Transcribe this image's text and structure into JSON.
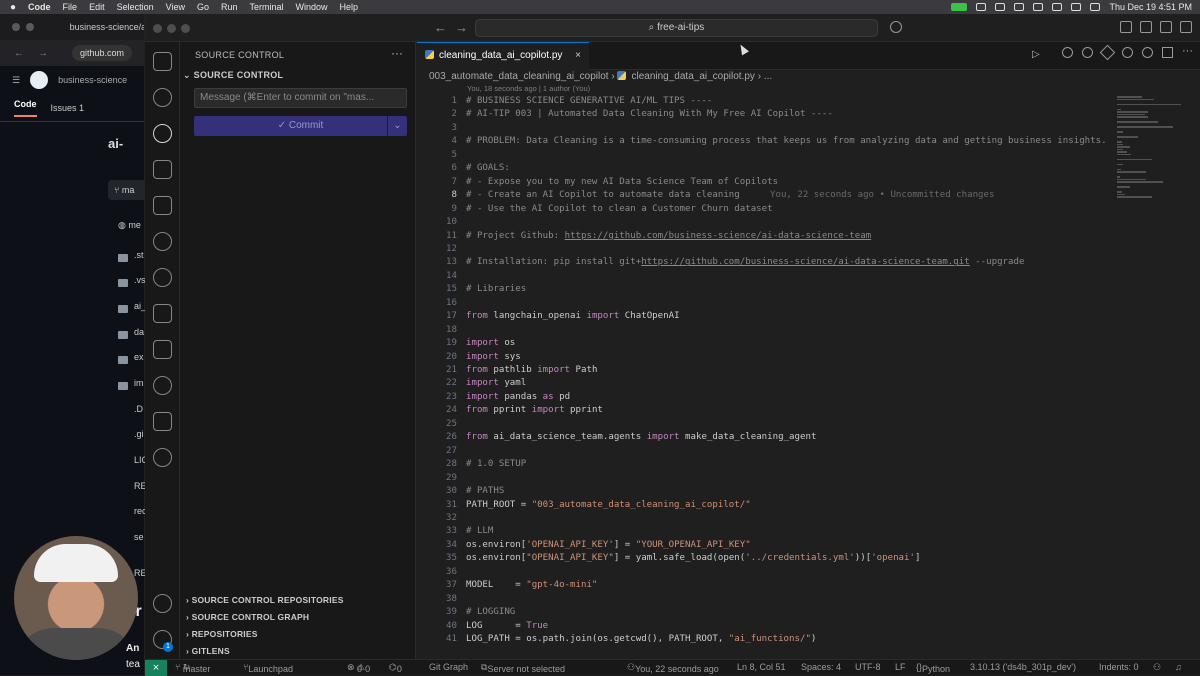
{
  "menubar": {
    "app": "Code",
    "items": [
      "File",
      "Edit",
      "Selection",
      "View",
      "Go",
      "Run",
      "Terminal",
      "Window",
      "Help"
    ],
    "datetime": "Thu Dec 19  4:51 PM"
  },
  "browser": {
    "tab_title": "business-science/a",
    "url": "github.com",
    "org": "business-science",
    "tab_code": "Code",
    "tab_issues": "Issues",
    "issues_count": "1",
    "repo_short": "ai-",
    "branch_short": "ma",
    "commit_short": "me",
    "files": [
      ".st",
      ".vs",
      "ai_",
      "da",
      "ex",
      "im",
      ".D",
      ".gi",
      "LIC",
      "RE",
      "rec",
      "se",
      "RE",
      "Ar",
      "An",
      "tea"
    ]
  },
  "window": {
    "command_center": "free-ai-tips"
  },
  "sidebar": {
    "title": "SOURCE CONTROL",
    "more": "···",
    "section": "SOURCE CONTROL",
    "message_placeholder": "Message (⌘Enter to commit on \"mas...",
    "commit_label": "✓ Commit",
    "panels": [
      "SOURCE CONTROL REPOSITORIES",
      "SOURCE CONTROL GRAPH",
      "REPOSITORIES",
      "GITLENS"
    ]
  },
  "editor": {
    "tab_label": "cleaning_data_ai_copilot.py",
    "tab_close": "×",
    "breadcrumb_folder": "003_automate_data_cleaning_ai_copilot",
    "breadcrumb_file": "cleaning_data_ai_copilot.py",
    "breadcrumb_more": "...",
    "blame_header": "You, 18 seconds ago | 1 author (You)",
    "ghost_text": "You, 22 seconds ago • Uncommitted changes",
    "current_line": 8,
    "lines": [
      [
        {
          "t": "# BUSINESS SCIENCE GENERATIVE AI/ML TIPS ----",
          "c": "c"
        }
      ],
      [
        {
          "t": "# AI-TIP 003 | Automated Data Cleaning With My Free AI Copilot ----",
          "c": "c"
        }
      ],
      [],
      [
        {
          "t": "# PROBLEM: Data Cleaning is a time-consuming process that keeps us from analyzing data and getting business insights.",
          "c": "c"
        }
      ],
      [],
      [
        {
          "t": "# GOALS:",
          "c": "c"
        }
      ],
      [
        {
          "t": "# - Expose you to my new AI Data Science Team of Copilots",
          "c": "c"
        }
      ],
      [
        {
          "t": "# - Create an AI Copilot to automate data cleaning",
          "c": "c"
        }
      ],
      [
        {
          "t": "# - Use the AI Copilot to clean a Customer Churn dataset",
          "c": "c"
        }
      ],
      [],
      [
        {
          "t": "# Project Github: ",
          "c": "c"
        },
        {
          "t": "https://github.com/business-science/ai-data-science-team",
          "c": "lnk"
        }
      ],
      [],
      [
        {
          "t": "# Installation: pip install git+",
          "c": "c"
        },
        {
          "t": "https://github.com/business-science/ai-data-science-team.git",
          "c": "lnk"
        },
        {
          "t": " --upgrade",
          "c": "c"
        }
      ],
      [],
      [
        {
          "t": "# Libraries",
          "c": "c"
        }
      ],
      [],
      [
        {
          "t": "from",
          "c": "kw"
        },
        {
          "t": " langchain_openai "
        },
        {
          "t": "import",
          "c": "kw"
        },
        {
          "t": " ChatOpenAI"
        }
      ],
      [],
      [
        {
          "t": "import",
          "c": "kw"
        },
        {
          "t": " os"
        }
      ],
      [
        {
          "t": "import",
          "c": "kw"
        },
        {
          "t": " sys"
        }
      ],
      [
        {
          "t": "from",
          "c": "kw"
        },
        {
          "t": " pathlib "
        },
        {
          "t": "import",
          "c": "kw"
        },
        {
          "t": " Path"
        }
      ],
      [
        {
          "t": "import",
          "c": "kw"
        },
        {
          "t": " yaml"
        }
      ],
      [
        {
          "t": "import",
          "c": "kw"
        },
        {
          "t": " pandas "
        },
        {
          "t": "as",
          "c": "kw"
        },
        {
          "t": " pd"
        }
      ],
      [
        {
          "t": "from",
          "c": "kw"
        },
        {
          "t": " pprint "
        },
        {
          "t": "import",
          "c": "kw"
        },
        {
          "t": " pprint"
        }
      ],
      [],
      [
        {
          "t": "from",
          "c": "kw"
        },
        {
          "t": " ai_data_science_team.agents "
        },
        {
          "t": "import",
          "c": "kw"
        },
        {
          "t": " make_data_cleaning_agent"
        }
      ],
      [],
      [
        {
          "t": "# 1.0 SETUP",
          "c": "c"
        }
      ],
      [],
      [
        {
          "t": "# PATHS",
          "c": "c"
        }
      ],
      [
        {
          "t": "PATH_ROOT = "
        },
        {
          "t": "\"003_automate_data_cleaning_ai_copilot/\"",
          "c": "str"
        }
      ],
      [],
      [
        {
          "t": "# LLM",
          "c": "c"
        }
      ],
      [
        {
          "t": "os.environ["
        },
        {
          "t": "'OPENAI_API_KEY'",
          "c": "str"
        },
        {
          "t": "] = "
        },
        {
          "t": "\"YOUR_OPENAI_API_KEY\"",
          "c": "str"
        }
      ],
      [
        {
          "t": "os.environ["
        },
        {
          "t": "\"OPENAI_API_KEY\"",
          "c": "str"
        },
        {
          "t": "] = yaml.safe_load(open("
        },
        {
          "t": "'../credentials.yml'",
          "c": "str"
        },
        {
          "t": "))["
        },
        {
          "t": "'openai'",
          "c": "str"
        },
        {
          "t": "]"
        }
      ],
      [],
      [
        {
          "t": "MODEL    = "
        },
        {
          "t": "\"gpt-4o-mini\"",
          "c": "str"
        }
      ],
      [],
      [
        {
          "t": "# LOGGING",
          "c": "c"
        }
      ],
      [
        {
          "t": "LOG      = "
        },
        {
          "t": "True",
          "c": "kw"
        }
      ],
      [
        {
          "t": "LOG_PATH = os.path.join(os.getcwd(), PATH_ROOT, "
        },
        {
          "t": "\"ai_functions/\"",
          "c": "str"
        },
        {
          "t": ")"
        }
      ]
    ]
  },
  "statusbar": {
    "branch": "master",
    "launchpad": "Launchpad",
    "errors": "0",
    "warnings": "0",
    "ports": "0",
    "git_graph": "Git Graph",
    "server": "Server not selected",
    "blame": "You, 22 seconds ago",
    "position": "Ln 8, Col 51",
    "spaces": "Spaces: 4",
    "encoding": "UTF-8",
    "eol": "LF",
    "language": "Python",
    "interpreter": "3.10.13 ('ds4b_301p_dev')",
    "indents": "Indents: 0"
  },
  "colors": {
    "accent": "#0078d4",
    "commit_button": "#35307a",
    "remote": "#16825d"
  }
}
